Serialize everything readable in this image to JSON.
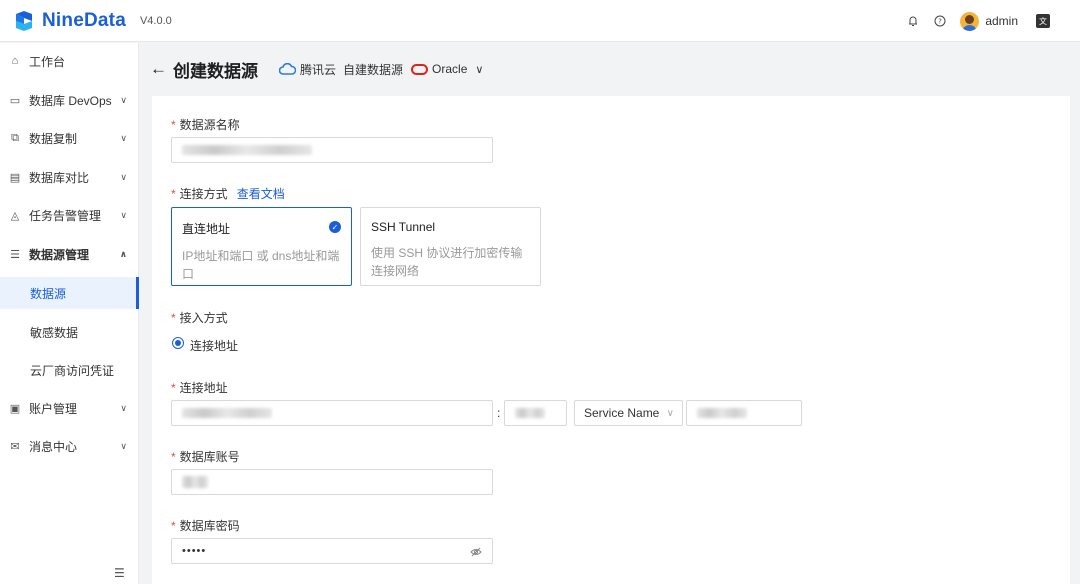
{
  "header": {
    "app_name": "NineData",
    "version": "V4.0.0",
    "username": "admin",
    "icons": [
      "bell-icon",
      "help-icon",
      "avatar",
      "language-icon"
    ]
  },
  "sidebar": {
    "items": [
      {
        "label": "工作台",
        "icon": "home-icon"
      },
      {
        "label": "数据库 DevOps",
        "icon": "monitor-icon"
      },
      {
        "label": "数据复制",
        "icon": "copy-icon"
      },
      {
        "label": "数据库对比",
        "icon": "compare-icon"
      },
      {
        "label": "任务告警管理",
        "icon": "alarm-icon"
      },
      {
        "label": "数据源管理",
        "icon": "datasource-icon"
      },
      {
        "label": "账户管理",
        "icon": "account-icon"
      },
      {
        "label": "消息中心",
        "icon": "mail-icon"
      }
    ],
    "sub_items": [
      {
        "label": "数据源",
        "active": true
      },
      {
        "label": "敏感数据",
        "active": false
      },
      {
        "label": "云厂商访问凭证",
        "active": false
      }
    ]
  },
  "page": {
    "title": "创建数据源",
    "cloud": "腾讯云",
    "source_type": "自建数据源",
    "db_type": "Oracle"
  },
  "form": {
    "name_label": "数据源名称",
    "conn_method_label": "连接方式",
    "doc_link": "查看文档",
    "options": [
      {
        "title": "直连地址",
        "desc": "IP地址和端口 或 dns地址和端口",
        "selected": true
      },
      {
        "title": "SSH Tunnel",
        "desc": "使用 SSH 协议进行加密传输连接网络",
        "selected": false
      }
    ],
    "access_label": "接入方式",
    "access_option": "连接地址",
    "address_label": "连接地址",
    "address_colon": ":",
    "service_select": "Service Name",
    "account_label": "数据库账号",
    "password_label": "数据库密码",
    "password_value": "•••••"
  },
  "colors": {
    "accent": "#1a5fd8",
    "required": "#e5484d",
    "oracle": "#e0231c"
  }
}
